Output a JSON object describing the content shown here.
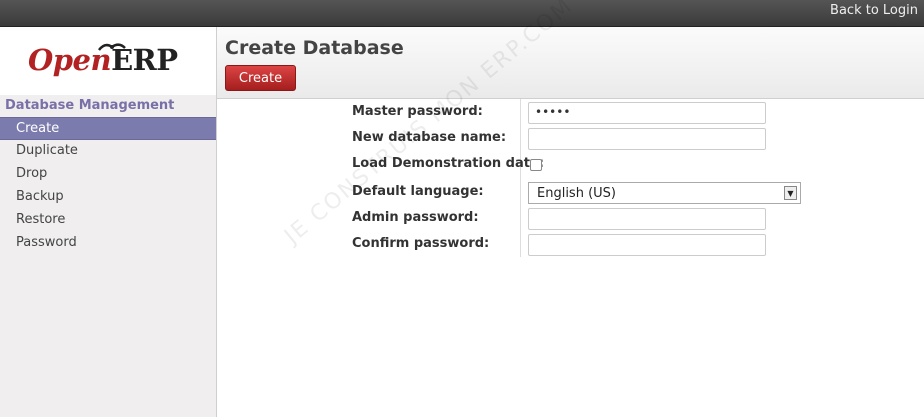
{
  "topbar": {
    "back_label": "Back to Login"
  },
  "logo": {
    "open": "Open",
    "erp": "ERP"
  },
  "sidebar": {
    "section_title": "Database Management",
    "items": [
      {
        "label": "Create"
      },
      {
        "label": "Duplicate"
      },
      {
        "label": "Drop"
      },
      {
        "label": "Backup"
      },
      {
        "label": "Restore"
      },
      {
        "label": "Password"
      }
    ]
  },
  "header": {
    "title": "Create Database",
    "create_label": "Create"
  },
  "form": {
    "master_password_label": "Master password:",
    "master_password_value": "•••••",
    "new_db_label": "New database name:",
    "new_db_value": "",
    "demo_label": "Load Demonstration data:",
    "demo_checked": false,
    "language_label": "Default language:",
    "language_value": "English (US)",
    "admin_password_label": "Admin password:",
    "admin_password_value": "",
    "confirm_password_label": "Confirm password:",
    "confirm_password_value": ""
  },
  "watermark": "JE CONSTRUIS MON ERP.COM"
}
